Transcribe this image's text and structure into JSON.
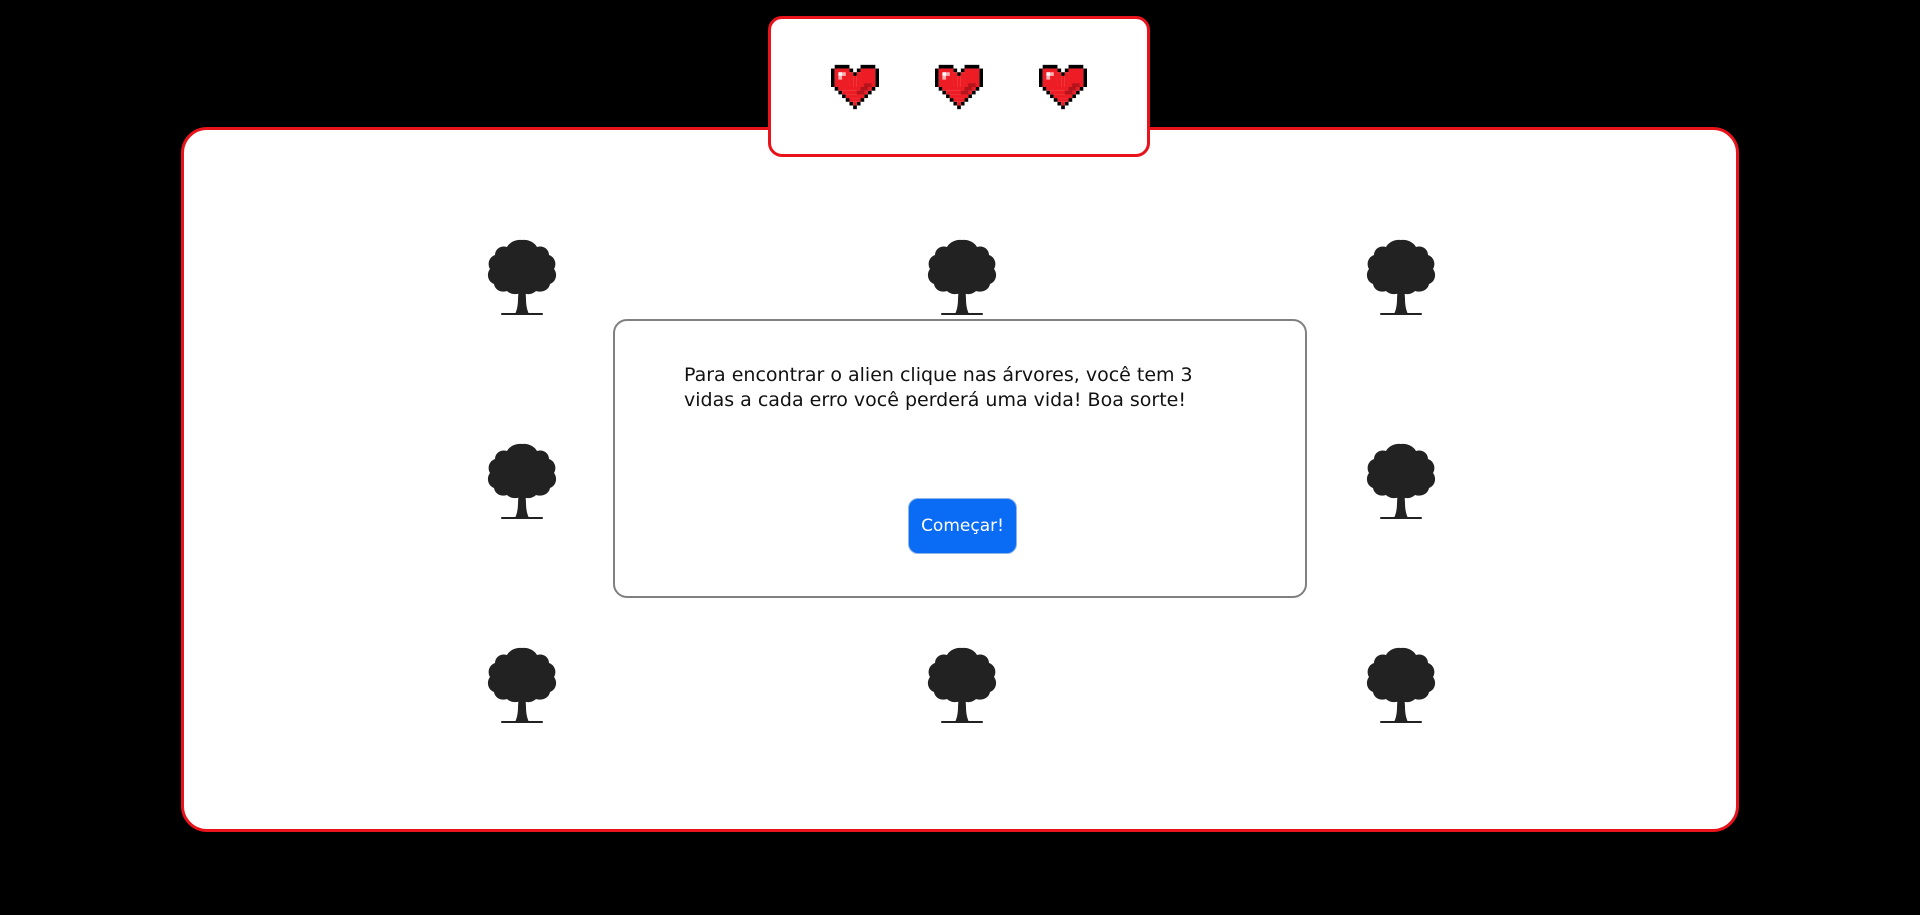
{
  "lives": {
    "current": 3,
    "max": 3,
    "hearts": [
      {
        "icon": "heart-icon",
        "state": "full"
      },
      {
        "icon": "heart-icon",
        "state": "full"
      },
      {
        "icon": "heart-icon",
        "state": "full"
      }
    ]
  },
  "board": {
    "trees": [
      {
        "icon": "tree-icon",
        "hidden_by_modal": false
      },
      {
        "icon": "tree-icon",
        "hidden_by_modal": false
      },
      {
        "icon": "tree-icon",
        "hidden_by_modal": false
      },
      {
        "icon": "tree-icon",
        "hidden_by_modal": false
      },
      {
        "icon": "tree-icon",
        "hidden_by_modal": true
      },
      {
        "icon": "tree-icon",
        "hidden_by_modal": false
      },
      {
        "icon": "tree-icon",
        "hidden_by_modal": false
      },
      {
        "icon": "tree-icon",
        "hidden_by_modal": false
      },
      {
        "icon": "tree-icon",
        "hidden_by_modal": false
      }
    ]
  },
  "modal": {
    "message": "Para encontrar o alien clique nas árvores, você tem 3 vidas a cada erro você perderá uma vida! Boa sorte!",
    "start_label": "Começar!"
  },
  "colors": {
    "background": "#000000",
    "panel_border": "#e8131b",
    "heart": "#ee1c24",
    "tree": "#222222",
    "button": "#0a6cf5"
  }
}
